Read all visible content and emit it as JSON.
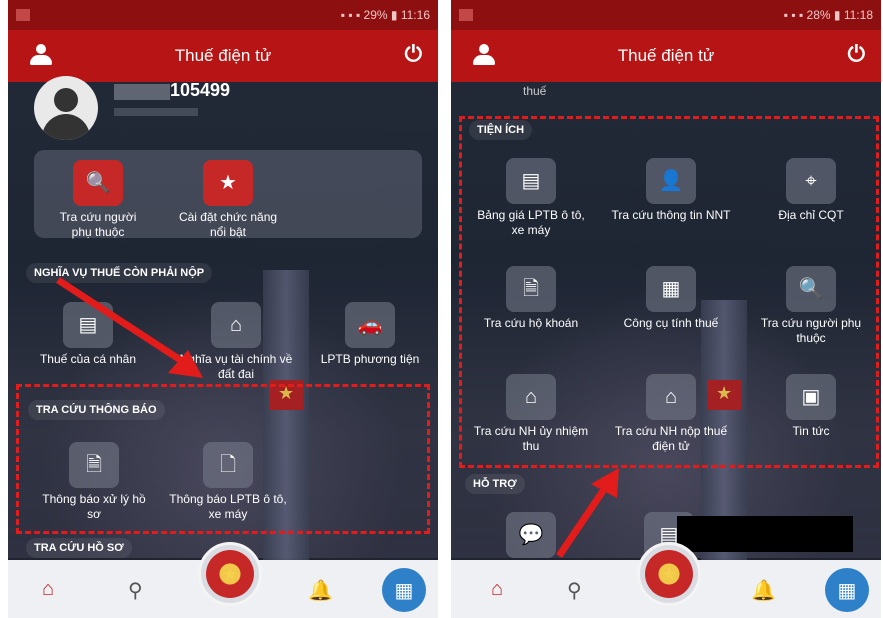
{
  "left": {
    "title": "Thuế điện tử",
    "user_id": "105499",
    "quick": [
      {
        "label": "Tra cứu người phụ thuộc",
        "icon": "search-icon"
      },
      {
        "label": "Cài đặt chức năng nổi bật",
        "icon": "star-icon"
      }
    ],
    "section1": "NGHĨA VỤ THUẾ CÒN PHẢI NỘP",
    "obligations": [
      {
        "label": "Thuế của cá nhân",
        "icon": "document-icon"
      },
      {
        "label": "Nghĩa vụ tài chính về đất đai",
        "icon": "house-icon"
      },
      {
        "label": "LPTB phương tiện",
        "icon": "car-icon"
      }
    ],
    "section2": "TRA CỨU THÔNG BÁO",
    "notices": [
      {
        "label": "Thông báo xử lý hồ sơ",
        "icon": "file-search-icon"
      },
      {
        "label": "Thông báo LPTB ô tô, xe máy",
        "icon": "car-doc-icon"
      }
    ],
    "section3": "TRA CỨU HỒ SƠ"
  },
  "right": {
    "title": "Thuế điện tử",
    "top_text": "thuế",
    "section": "TIỆN ÍCH",
    "utilities": [
      {
        "label": "Bảng giá LPTB ô tô, xe máy",
        "icon": "price-list-icon"
      },
      {
        "label": "Tra cứu thông tin NNT",
        "icon": "user-search-icon"
      },
      {
        "label": "Địa chỉ CQT",
        "icon": "map-icon"
      },
      {
        "label": "Tra cứu hộ khoán",
        "icon": "file-icon"
      },
      {
        "label": "Công cụ tính thuế",
        "icon": "calculator-icon"
      },
      {
        "label": "Tra cứu người phụ thuộc",
        "icon": "search-icon"
      },
      {
        "label": "Tra cứu NH ủy nhiệm thu",
        "icon": "bank-icon"
      },
      {
        "label": "Tra cứu NH nộp thuế điện tử",
        "icon": "bank-icon"
      },
      {
        "label": "Tin tức",
        "icon": "news-icon"
      }
    ],
    "support": "HỖ TRỢ"
  },
  "colors": {
    "accent": "#b71515",
    "highlight": "#e21b1b",
    "nav_button": "#2e80c8"
  }
}
